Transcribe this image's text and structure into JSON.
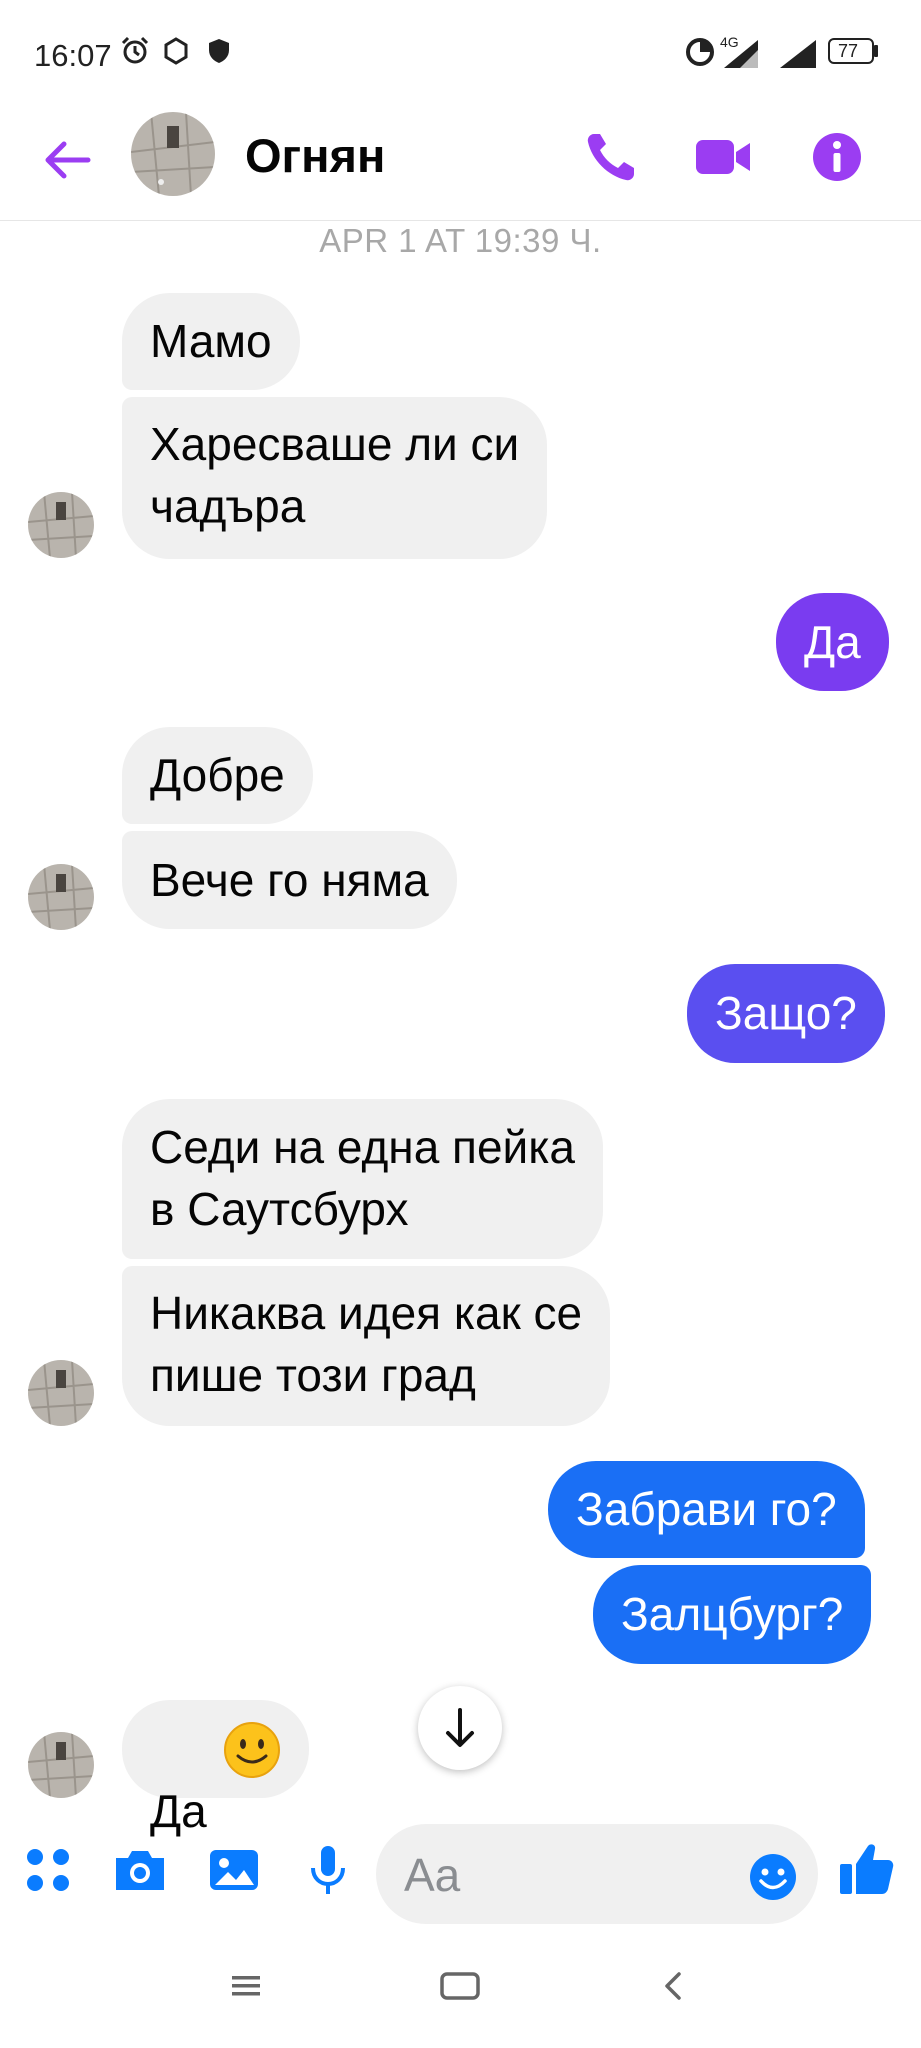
{
  "status_bar": {
    "time": "16:07",
    "network": "4G",
    "battery": "77"
  },
  "header": {
    "contact_name": "Огнян"
  },
  "chat": {
    "timestamp": "APR 1 AT 19:39 Ч.",
    "messages": [
      {
        "from": "in",
        "text": "Мамо"
      },
      {
        "from": "in",
        "text": "Харесваше ли си\nчадъра"
      },
      {
        "from": "out",
        "text": "Да"
      },
      {
        "from": "in",
        "text": "Добре"
      },
      {
        "from": "in",
        "text": "Вече го няма"
      },
      {
        "from": "out",
        "text": "Защо?"
      },
      {
        "from": "in",
        "text": "Седи на една пейка\nв Саутсбурх"
      },
      {
        "from": "in",
        "text": "Никаква идея как се\nпише този град"
      },
      {
        "from": "out",
        "text": "Забрави го?"
      },
      {
        "from": "out",
        "text": "Залцбург?"
      },
      {
        "from": "in",
        "text": "Да"
      }
    ]
  },
  "composer": {
    "placeholder": "Aa"
  },
  "colors": {
    "accent_purple": "#9b3df2",
    "bubble_out_violet": "#7a3cf0",
    "bubble_out_indigo": "#5a4ff0",
    "bubble_out_blue": "#1a6ff5",
    "composer_blue": "#0a7cff"
  },
  "icons": {
    "header": [
      "back-arrow-icon",
      "phone-icon",
      "video-icon",
      "info-icon"
    ],
    "composer": [
      "apps-icon",
      "camera-icon",
      "image-icon",
      "microphone-icon",
      "emoji-icon",
      "thumbs-up-icon"
    ],
    "nav": [
      "menu-icon",
      "home-icon",
      "back-icon"
    ]
  }
}
